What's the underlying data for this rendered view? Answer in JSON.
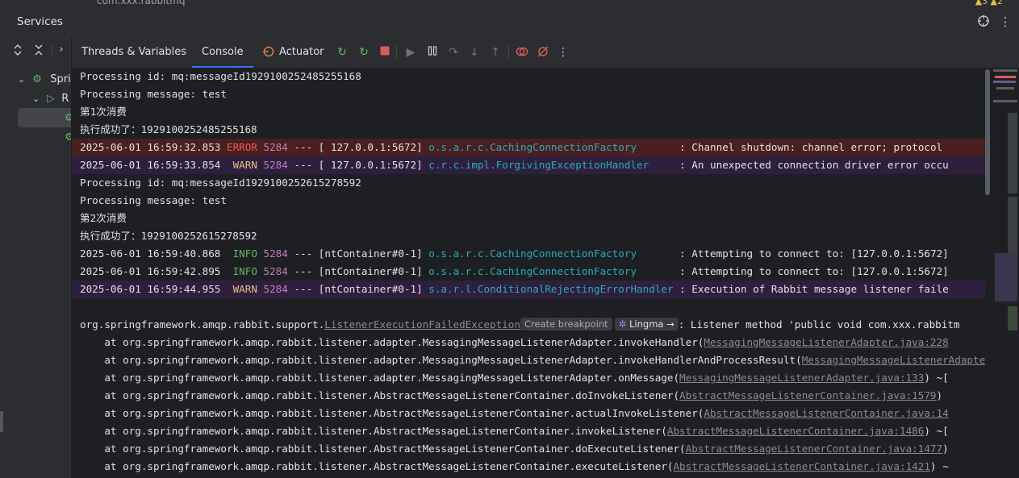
{
  "window": {
    "top_crumb": "com.xxx.rabbitmq",
    "problems": "▲3  ▲2",
    "title": "Services"
  },
  "header_icons": [
    "crosshair-icon",
    "more-vert-icon"
  ],
  "left_toolbar": [
    "expand-all-icon",
    "collapse-all-icon",
    "chevron-right-icon"
  ],
  "tree": {
    "root_label": "Sprin",
    "child_label": "R"
  },
  "tabs": [
    {
      "label": "Threads & Variables",
      "active": false
    },
    {
      "label": "Console",
      "active": true
    },
    {
      "label": "Actuator",
      "active": false
    }
  ],
  "toolbar_icons": [
    "rerun-icon",
    "rerun-debug-icon",
    "stop-icon",
    "resume-icon",
    "pause-icon",
    "step-over-icon",
    "step-into-icon",
    "step-out-icon",
    "view-breakpoints-icon",
    "mute-breakpoints-icon",
    "more-icon"
  ],
  "console": {
    "l1": "Processing id: mq:messageId1929100252485255168",
    "l2": "Processing message: test",
    "l3": "第1次消费",
    "l4": "执行成功了：1929100252485255168",
    "l5": {
      "ts": "2025-06-01 16:59:32.853",
      "lvl": "ERROR",
      "pid": "5284",
      "mid": "--- [ 127.0.0.1:5672]",
      "logger": "o.s.a.r.c.CachingConnectionFactory      ",
      "msg": " : Channel shutdown: channel error; protocol"
    },
    "l6": {
      "ts": "2025-06-01 16:59:33.854",
      "lvl": " WARN",
      "pid": "5284",
      "mid": "--- [ 127.0.0.1:5672]",
      "logger": "c.r.c.impl.ForgivingExceptionHandler    ",
      "msg": " : An unexpected connection driver error occu"
    },
    "l7": "Processing id: mq:messageId1929100252615278592",
    "l8": "Processing message: test",
    "l9": "第2次消费",
    "l10": "执行成功了：1929100252615278592",
    "l11": {
      "ts": "2025-06-01 16:59:40.868",
      "lvl": " INFO",
      "pid": "5284",
      "mid": "--- [ntContainer#0-1]",
      "logger": "o.s.a.r.c.CachingConnectionFactory      ",
      "msg": " : Attempting to connect to: [127.0.0.1:5672]"
    },
    "l12": {
      "ts": "2025-06-01 16:59:42.895",
      "lvl": " INFO",
      "pid": "5284",
      "mid": "--- [ntContainer#0-1]",
      "logger": "o.s.a.r.c.CachingConnectionFactory      ",
      "msg": " : Attempting to connect to: [127.0.0.1:5672]"
    },
    "l13": {
      "ts": "2025-06-01 16:59:44.955",
      "lvl": " WARN",
      "pid": "5284",
      "mid": "--- [ntContainer#0-1]",
      "logger": "s.a.r.l.ConditionalRejectingErrorHandler",
      "msg": " : Execution of Rabbit message listener faile"
    },
    "ex": {
      "prefix": "org.springframework.amqp.rabbit.support.",
      "cls": "ListenerExecutionFailedException",
      "hint_bp": "Create breakpoint",
      "hint_lm": "Lingma →",
      "suffix": ": Listener method 'public void com.xxx.rabbitm"
    },
    "stack": [
      {
        "pre": "    at org.springframework.amqp.rabbit.listener.adapter.MessagingMessageListenerAdapter.invokeHandler(",
        "link": "MessagingMessageListenerAdapter.java:228",
        "post": ""
      },
      {
        "pre": "    at org.springframework.amqp.rabbit.listener.adapter.MessagingMessageListenerAdapter.invokeHandlerAndProcessResult(",
        "link": "MessagingMessageListenerAdapter",
        "post": ""
      },
      {
        "pre": "    at org.springframework.amqp.rabbit.listener.adapter.MessagingMessageListenerAdapter.onMessage(",
        "link": "MessagingMessageListenerAdapter.java:133",
        "post": ") ~["
      },
      {
        "pre": "    at org.springframework.amqp.rabbit.listener.AbstractMessageListenerContainer.doInvokeListener(",
        "link": "AbstractMessageListenerContainer.java:1579",
        "post": ")"
      },
      {
        "pre": "    at org.springframework.amqp.rabbit.listener.AbstractMessageListenerContainer.actualInvokeListener(",
        "link": "AbstractMessageListenerContainer.java:14",
        "post": ""
      },
      {
        "pre": "    at org.springframework.amqp.rabbit.listener.AbstractMessageListenerContainer.invokeListener(",
        "link": "AbstractMessageListenerContainer.java:1486",
        "post": ") ~["
      },
      {
        "pre": "    at org.springframework.amqp.rabbit.listener.AbstractMessageListenerContainer.doExecuteListener(",
        "link": "AbstractMessageListenerContainer.java:1477",
        "post": ")"
      },
      {
        "pre": "    at org.springframework.amqp.rabbit.listener.AbstractMessageListenerContainer.executeListener(",
        "link": "AbstractMessageListenerContainer.java:1421",
        "post": ") ~"
      }
    ]
  },
  "colors": {
    "accent": "#3574f0",
    "error_bg": "#4a1f1f",
    "warn_bg": "#2e1f3e",
    "logger": "#2aacb8",
    "pid": "#c77dbb",
    "info": "#5fb865",
    "error": "#f75464",
    "warn": "#e5c07b"
  }
}
